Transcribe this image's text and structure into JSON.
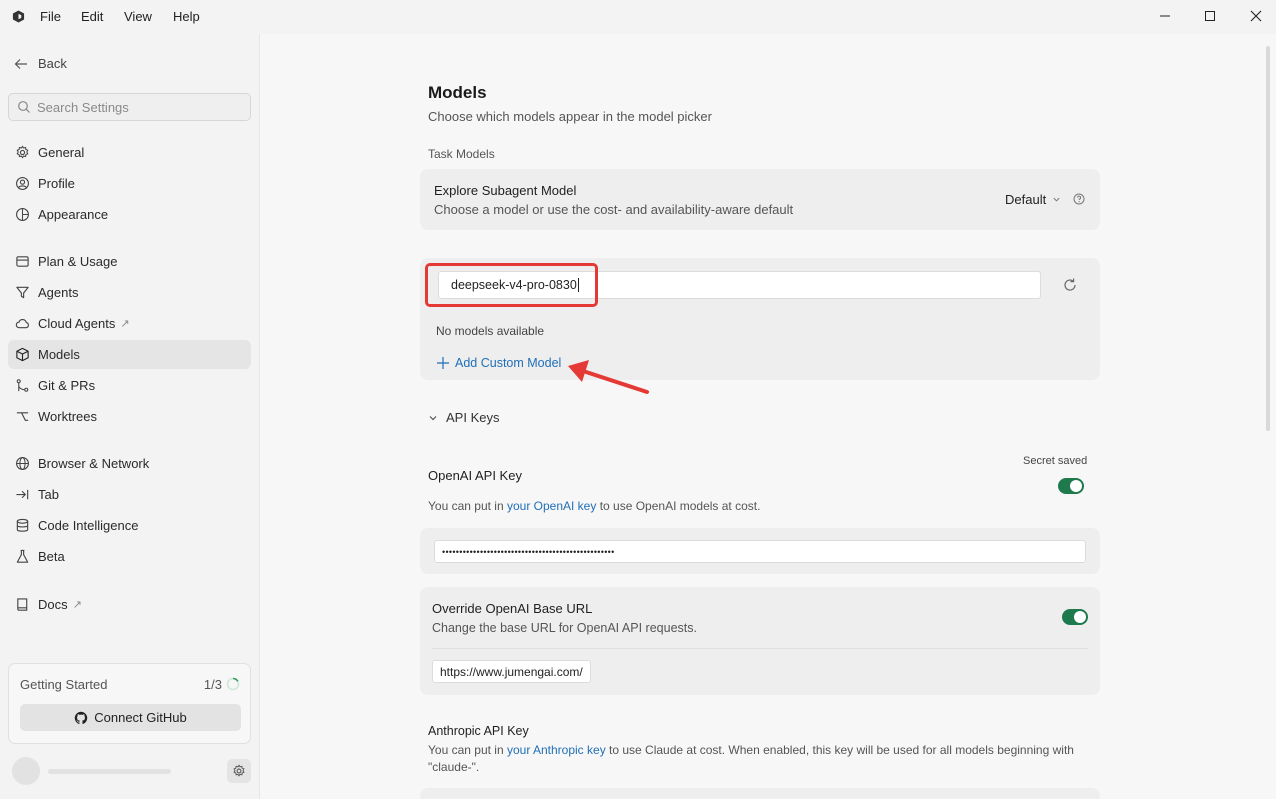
{
  "menu": {
    "file": "File",
    "edit": "Edit",
    "view": "View",
    "help": "Help"
  },
  "sidebar": {
    "back": "Back",
    "search_placeholder": "Search Settings",
    "items": [
      {
        "label": "General",
        "icon": "gear-icon"
      },
      {
        "label": "Profile",
        "icon": "user-circle-icon"
      },
      {
        "label": "Appearance",
        "icon": "palette-icon"
      },
      {
        "label": "Plan & Usage",
        "icon": "receipt-icon"
      },
      {
        "label": "Agents",
        "icon": "filter-icon"
      },
      {
        "label": "Cloud Agents",
        "icon": "cloud-icon",
        "external": "↗"
      },
      {
        "label": "Models",
        "icon": "cube-icon",
        "active": true
      },
      {
        "label": "Git & PRs",
        "icon": "git-icon"
      },
      {
        "label": "Worktrees",
        "icon": "branch-icon"
      },
      {
        "label": "Browser & Network",
        "icon": "globe-icon"
      },
      {
        "label": "Tab",
        "icon": "tab-icon"
      },
      {
        "label": "Code Intelligence",
        "icon": "database-icon"
      },
      {
        "label": "Beta",
        "icon": "flask-icon"
      },
      {
        "label": "Docs",
        "icon": "book-icon",
        "external": "↗"
      }
    ],
    "getting_started": {
      "title": "Getting Started",
      "progress": "1/3",
      "button": "Connect GitHub"
    }
  },
  "main": {
    "title": "Models",
    "subtitle": "Choose which models appear in the model picker",
    "task_models_label": "Task Models",
    "explore": {
      "title": "Explore Subagent Model",
      "desc": "Choose a model or use the cost- and availability-aware default",
      "select_value": "Default"
    },
    "model_search_value": "deepseek-v4-pro-0830",
    "no_models": "No models available",
    "add_custom": "Add Custom Model",
    "api_keys_label": "API Keys",
    "openai": {
      "title": "OpenAI API Key",
      "secret_saved": "Secret saved",
      "desc_pre": "You can put in ",
      "desc_link": "your OpenAI key",
      "desc_post": " to use OpenAI models at cost.",
      "key_value": "••••••••••••••••••••••••••••••••••••••••••••••••••",
      "enabled": true
    },
    "override": {
      "title": "Override OpenAI Base URL",
      "desc": "Change the base URL for OpenAI API requests.",
      "url_value": "https://www.jumengai.com/",
      "enabled": true
    },
    "anthropic": {
      "title": "Anthropic API Key",
      "desc_pre": "You can put in ",
      "desc_link": "your Anthropic key",
      "desc_post": " to use Claude at cost. When enabled, this key will be used for all models beginning with",
      "desc_line2": "\"claude-\"."
    }
  },
  "colors": {
    "accent_green": "#1e7a4d",
    "link_blue": "#1f6fb8",
    "annotation_red": "#e53935"
  }
}
